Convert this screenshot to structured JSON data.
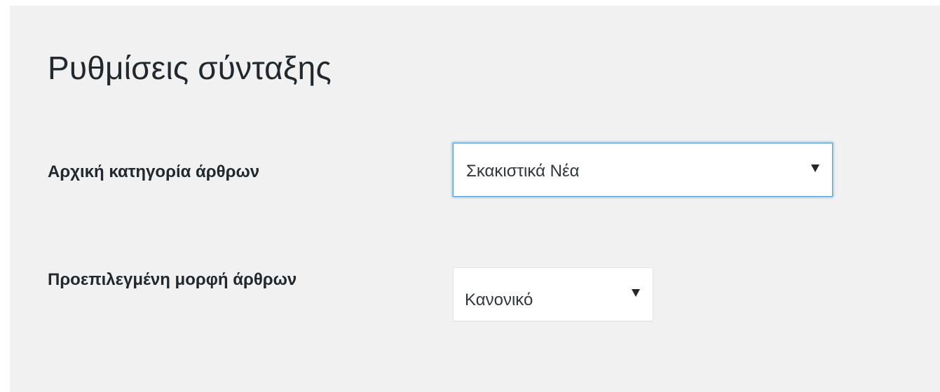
{
  "page": {
    "title": "Ρυθμίσεις σύνταξης"
  },
  "fields": {
    "default_category": {
      "label": "Αρχική κατηγορία άρθρων",
      "selected_value": "Σκακιστικά Νέα",
      "state": "focused"
    },
    "default_format": {
      "label": "Προεπιλεγμένη μορφή άρθρων",
      "selected_value": "Κανονικό"
    }
  },
  "icons": {
    "dropdown": "chevron-down-icon"
  },
  "colors": {
    "background": "#f1f1f1",
    "text": "#23282d",
    "focus_border": "#5b9dd9",
    "field_border": "#e5e5e5"
  }
}
